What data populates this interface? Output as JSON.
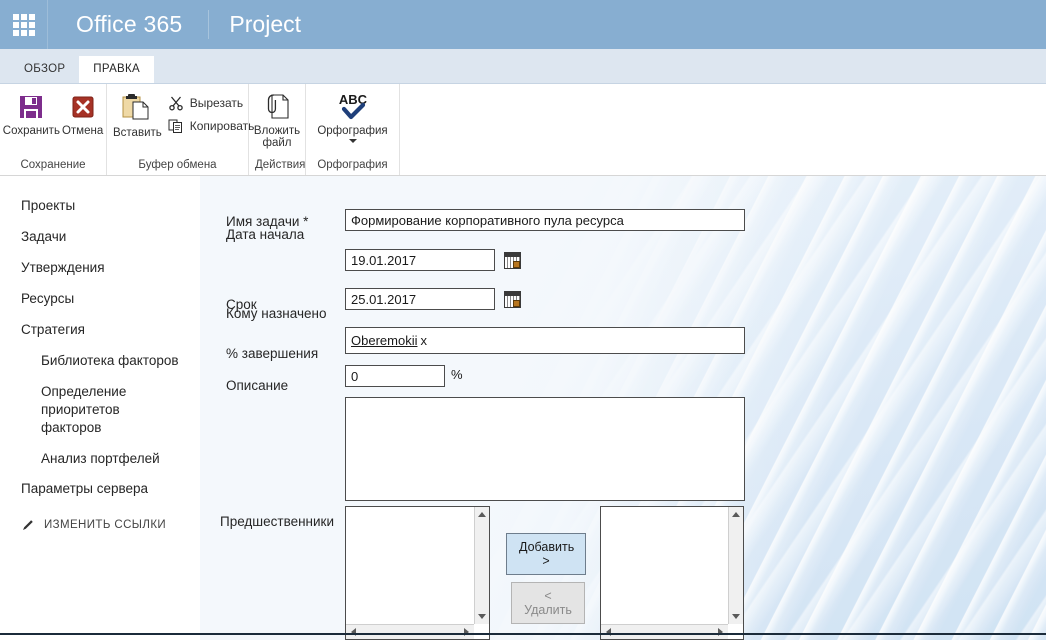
{
  "suite_bar": {
    "waffle_icon": "app-launcher-icon",
    "brand": "Office 365",
    "site": "Project"
  },
  "ribbon": {
    "tabs": [
      {
        "label": "ОБЗОР",
        "active": false
      },
      {
        "label": "ПРАВКА",
        "active": true
      }
    ],
    "groups": [
      {
        "title": "Сохранение",
        "buttons": [
          {
            "label": "Сохранить",
            "icon": "save-floppy-icon",
            "color": "#7d2d8c"
          },
          {
            "label": "Отмена",
            "icon": "cancel-x-icon",
            "color": "#a63226"
          }
        ]
      },
      {
        "title": "Буфер обмена",
        "buttons": [
          {
            "label": "Вставить",
            "icon": "paste-clipboard-icon"
          },
          {
            "label": "Вырезать",
            "icon": "scissors-icon"
          },
          {
            "label": "Копировать",
            "icon": "copy-icon"
          }
        ]
      },
      {
        "title": "Действия",
        "buttons": [
          {
            "label": "Вложить файл",
            "icon": "attach-file-icon"
          }
        ]
      },
      {
        "title": "Орфография",
        "buttons": [
          {
            "label": "Орфография",
            "icon": "spelling-abc-check-icon",
            "caret": true
          }
        ]
      }
    ]
  },
  "sidebar": {
    "items": [
      {
        "label": "Проекты",
        "level": 0
      },
      {
        "label": "Задачи",
        "level": 0
      },
      {
        "label": "Утверждения",
        "level": 0
      },
      {
        "label": "Ресурсы",
        "level": 0
      },
      {
        "label": "Стратегия",
        "level": 0
      },
      {
        "label": "Библиотека факторов",
        "level": 1
      },
      {
        "label": "Определение приоритетов факторов",
        "level": 1
      },
      {
        "label": "Анализ портфелей",
        "level": 1
      },
      {
        "label": "Параметры сервера",
        "level": 0
      }
    ],
    "edit_links": {
      "label": "ИЗМЕНИТЬ ССЫЛКИ",
      "icon": "pencil-icon"
    }
  },
  "form": {
    "task_name": {
      "label": "Имя задачи *",
      "value": "Формирование корпоративного пула ресурса",
      "placeholder": ""
    },
    "start_date": {
      "label": "Дата начала",
      "value": "19.01.2017",
      "placeholder": "",
      "picker_icon": "calendar-icon"
    },
    "due_date": {
      "label": "Срок",
      "value": "25.01.2017",
      "placeholder": "",
      "picker_icon": "calendar-icon"
    },
    "assigned_to": {
      "label": "Кому назначено",
      "value": "Oberemokii",
      "remove_glyph": "x",
      "placeholder": ""
    },
    "percent_complete": {
      "label": "% завершения",
      "value": "0",
      "suffix": "%",
      "placeholder": ""
    },
    "description": {
      "label": "Описание",
      "value": "",
      "placeholder": ""
    },
    "predecessors": {
      "label": "Предшественники",
      "available_items": [],
      "selected_items": [],
      "add_button": "Добавить >",
      "remove_button": "< Удалить"
    }
  },
  "colors": {
    "suite_bar": "#87aed1",
    "tabstrip": "#dde6f0",
    "content_bg": "#f4f8fc",
    "primary_button": "#cfe3f3",
    "save_icon": "#7d2d8c",
    "cancel_icon": "#a63226"
  }
}
